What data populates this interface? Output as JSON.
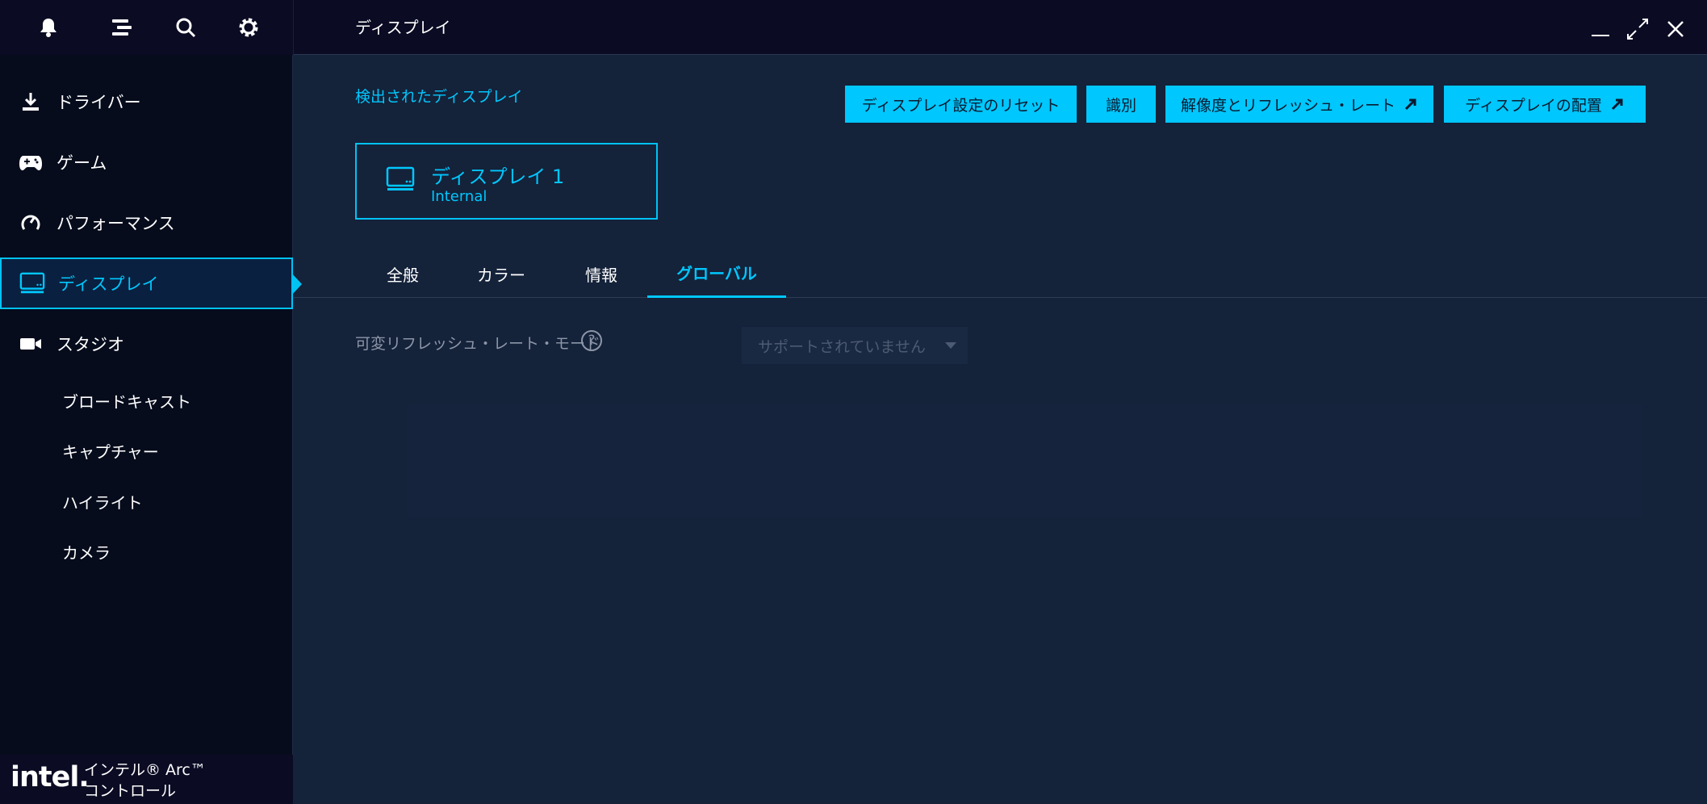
{
  "window": {
    "title": "ディスプレイ"
  },
  "sidebar": {
    "top_icons": [
      "bell-icon",
      "menu-icon",
      "search-icon",
      "gear-icon"
    ],
    "items": [
      {
        "label": "ドライバー",
        "icon": "download-icon"
      },
      {
        "label": "ゲーム",
        "icon": "gamepad-icon"
      },
      {
        "label": "パフォーマンス",
        "icon": "gauge-icon"
      },
      {
        "label": "ディスプレイ",
        "icon": "monitor-icon",
        "active": true
      },
      {
        "label": "スタジオ",
        "icon": "camera-icon"
      }
    ],
    "sub_items": [
      "ブロードキャスト",
      "キャプチャー",
      "ハイライト",
      "カメラ"
    ],
    "brand": {
      "logo": "intel.",
      "line1": "インテル® Arc™",
      "line2": "コントロール"
    }
  },
  "main": {
    "detected_label": "検出されたディスプレイ",
    "buttons": {
      "reset": "ディスプレイ設定のリセット",
      "identify": "識別",
      "resolution": "解像度とリフレッシュ・レート",
      "arrangement": "ディスプレイの配置"
    },
    "display_card": {
      "name": "ディスプレイ 1",
      "sub": "Internal"
    },
    "tabs": [
      "全般",
      "カラー",
      "情報",
      "グローバル"
    ],
    "active_tab": "グローバル",
    "setting": {
      "label": "可変リフレッシュ・レート・モード",
      "help": "?",
      "value": "サポートされていません"
    }
  },
  "colors": {
    "accent": "#00c7fd",
    "sidebar_bg": "#060c1c",
    "main_bg": "#14223a",
    "titlebar_bg": "#0b0b24"
  }
}
